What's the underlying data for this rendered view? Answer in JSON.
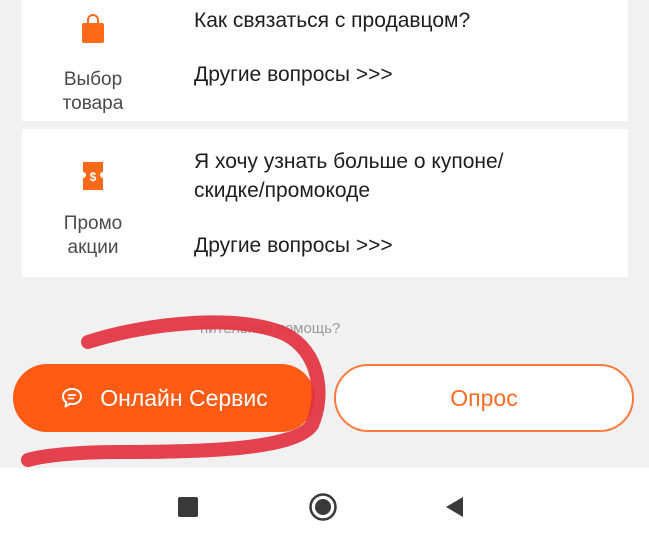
{
  "faq": {
    "categories": [
      {
        "label": "Выбор\nтовара",
        "icon": "shopping-bag-icon",
        "question": "Как связаться с продавцом?",
        "more_link": "Другие вопросы >>>"
      },
      {
        "label": "Промо\nакции",
        "icon": "coupon-icon",
        "question": "Я хочу узнать больше о купоне/\nскидке/промокоде",
        "more_link": "Другие вопросы >>>"
      }
    ]
  },
  "help": {
    "text": "нительная помощь?",
    "online_button": "Онлайн Сервис",
    "survey_button": "Опрос"
  },
  "colors": {
    "accent": "#ff5b14",
    "annotation": "#e2323f"
  }
}
